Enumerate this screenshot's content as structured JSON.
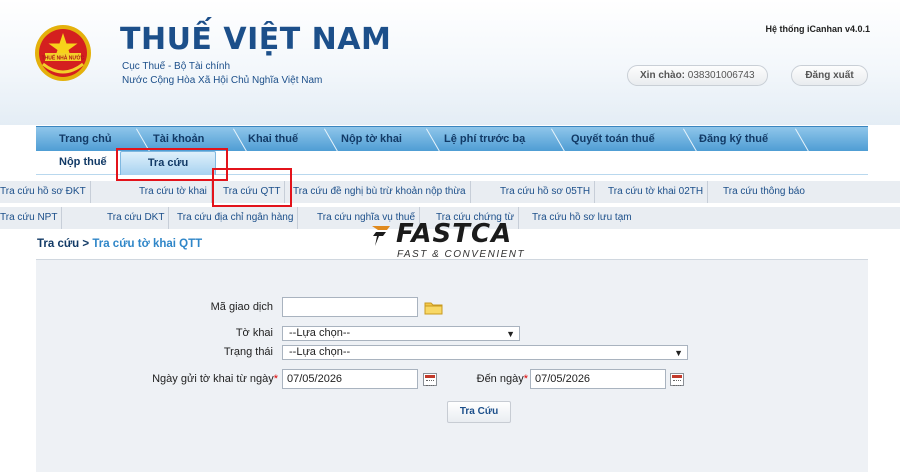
{
  "header": {
    "brand_title": "THUẾ VIỆT NAM",
    "brand_sub1": "Cục Thuế - Bộ Tài chính",
    "brand_sub2": "Nước Cộng Hòa Xã Hội Chủ Nghĩa Việt Nam",
    "logo_text": "THUẾ NHÀ NƯỚC",
    "system_version": "Hệ thống iCanhan v4.0.1",
    "greeting_label": "Xin chào:",
    "greeting_user": "038301006743",
    "logout_label": "Đăng xuất"
  },
  "main_nav": {
    "items": [
      "Trang chủ",
      "Tài khoản",
      "Khai thuế",
      "Nộp tờ khai",
      "Lệ phí trước bạ",
      "Quyết toán thuế",
      "Đăng ký thuế"
    ]
  },
  "sub_tabs": {
    "items": [
      "Nộp thuế",
      "Tra cứu"
    ],
    "active": "Tra cứu"
  },
  "links": {
    "row1": [
      "Tra cứu hồ sơ ĐKT",
      "Tra cứu tờ khai",
      "Tra cứu QTT",
      "Tra cứu đề nghị bù trừ khoản nộp thừa",
      "Tra cứu hồ sơ 05TH",
      "Tra cứu tờ khai 02TH",
      "Tra cứu thông báo"
    ],
    "row2": [
      "Tra cứu NPT",
      "Tra cứu DKT",
      "Tra cứu địa chỉ ngân hàng",
      "Tra cứu nghĩa vụ thuế",
      "Tra cứu chứng từ",
      "Tra cứu hồ sơ lưu tạm"
    ]
  },
  "breadcrumb": {
    "root": "Tra cứu",
    "separator": ">",
    "current": "Tra cứu tờ khai QTT"
  },
  "watermark": {
    "title": "FASTCA",
    "subtitle": "FAST & CONVENIENT"
  },
  "form": {
    "transaction_code_label": "Mã giao dịch",
    "transaction_code_value": "",
    "declaration_label": "Tờ khai",
    "declaration_value": "--Lựa chọn--",
    "status_label": "Trạng thái",
    "status_value": "--Lựa chọn--",
    "from_date_label": "Ngày gửi tờ khai từ ngày",
    "from_date_value": "07/05/2026",
    "to_date_label": "Đến ngày",
    "to_date_value": "07/05/2026",
    "required_mark": "*",
    "search_button": "Tra Cứu"
  },
  "colors": {
    "brand_blue": "#1c4f8a",
    "nav_blue": "#4f9dd4",
    "link_blue": "#2f86c8",
    "annotation_red": "#e3131b"
  }
}
